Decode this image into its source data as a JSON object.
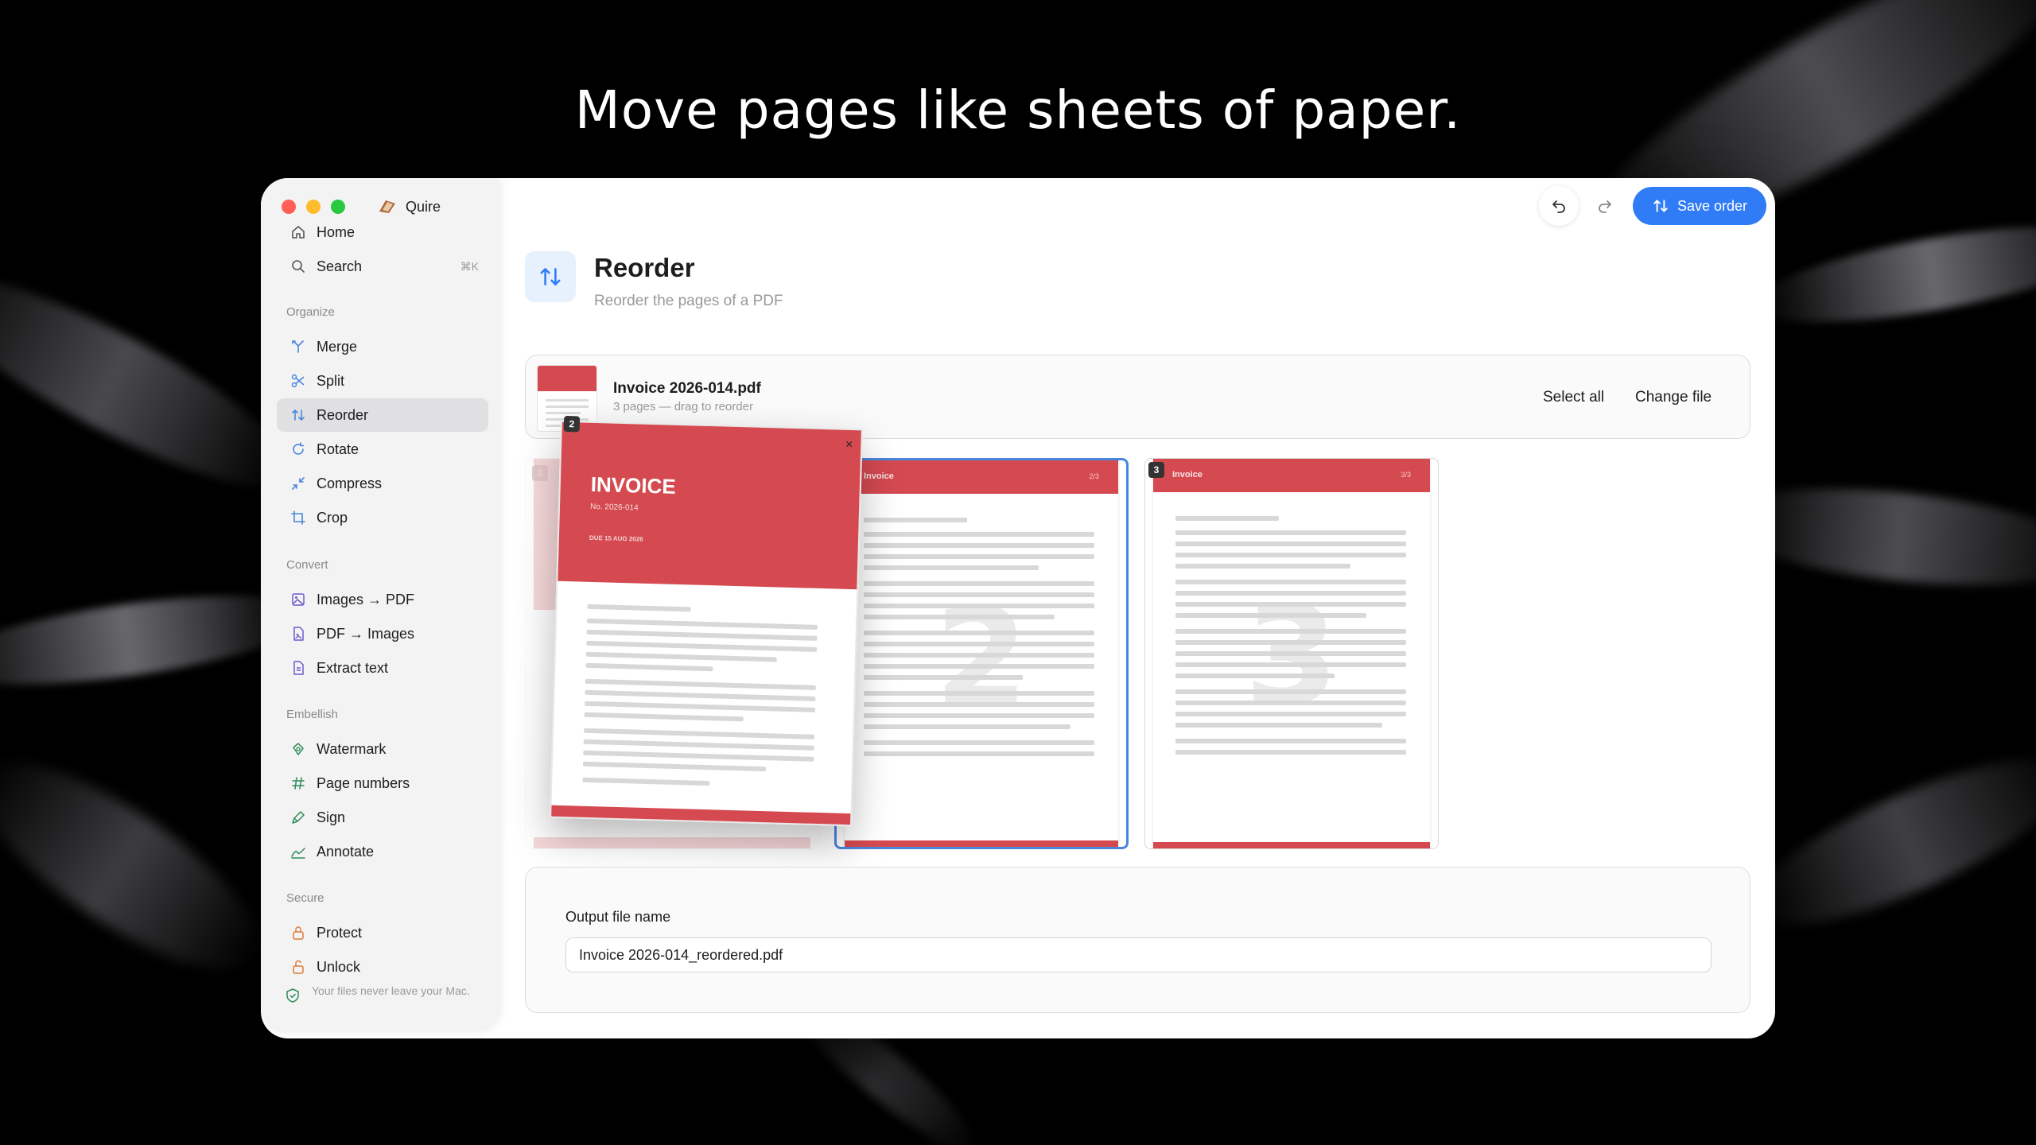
{
  "headline": "Move pages like sheets of paper.",
  "app": {
    "name": "Quire",
    "colors": {
      "accent": "#2f7cf6",
      "invoice_red": "#d54a51",
      "sidebar_bg": "#f3f3f4"
    }
  },
  "sidebar": {
    "top": [
      {
        "label": "Home",
        "icon": "home-icon"
      },
      {
        "label": "Search",
        "icon": "search-icon",
        "shortcut": "⌘K"
      }
    ],
    "sections": [
      {
        "title": "Organize",
        "items": [
          {
            "label": "Merge",
            "icon": "merge-icon"
          },
          {
            "label": "Split",
            "icon": "scissors-icon"
          },
          {
            "label": "Reorder",
            "icon": "reorder-icon",
            "active": true
          },
          {
            "label": "Rotate",
            "icon": "rotate-icon"
          },
          {
            "label": "Compress",
            "icon": "compress-icon"
          },
          {
            "label": "Crop",
            "icon": "crop-icon"
          }
        ]
      },
      {
        "title": "Convert",
        "items": [
          {
            "label": "Images → PDF",
            "icon": "image-icon"
          },
          {
            "label": "PDF → Images",
            "icon": "pdf-image-icon"
          },
          {
            "label": "Extract text",
            "icon": "document-icon"
          }
        ]
      },
      {
        "title": "Embellish",
        "items": [
          {
            "label": "Watermark",
            "icon": "watermark-icon"
          },
          {
            "label": "Page numbers",
            "icon": "hash-icon"
          },
          {
            "label": "Sign",
            "icon": "pen-icon"
          },
          {
            "label": "Annotate",
            "icon": "signature-icon"
          }
        ]
      },
      {
        "title": "Secure",
        "items": [
          {
            "label": "Protect",
            "icon": "lock-icon"
          },
          {
            "label": "Unlock",
            "icon": "unlock-icon"
          }
        ]
      }
    ],
    "privacy_note": "Your files never leave your Mac."
  },
  "toolbar": {
    "save_label": "Save order"
  },
  "page": {
    "title": "Reorder",
    "subtitle": "Reorder the pages of a PDF"
  },
  "file": {
    "name": "Invoice 2026-014.pdf",
    "meta": "3 pages — drag to reorder",
    "select_all": "Select all",
    "change_file": "Change file"
  },
  "pages": [
    {
      "number": "2",
      "header": "Invoice",
      "page_label": "2/3",
      "digit": "2"
    },
    {
      "number": "3",
      "header": "Invoice",
      "page_label": "3/3",
      "digit": "3"
    }
  ],
  "ghost_number": "2",
  "dragged_page": {
    "number": "2",
    "title": "INVOICE",
    "invoice_no": "No. 2026-014",
    "due": "DUE 15 AUG 2026",
    "close_glyph": "×"
  },
  "output": {
    "label": "Output file name",
    "value": "Invoice 2026-014_reordered.pdf"
  }
}
